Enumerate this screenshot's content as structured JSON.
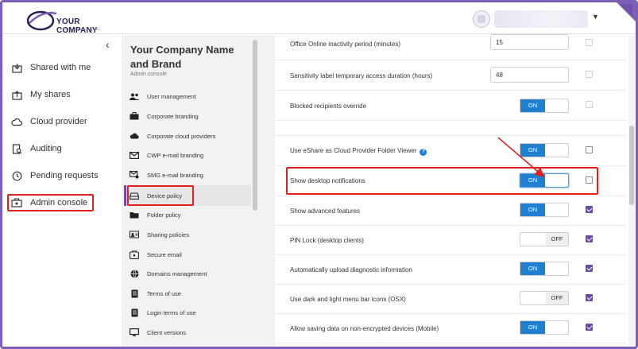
{
  "header": {
    "logo_text": "YOUR COMPANY",
    "logo_subtext": "NAME AND BRANDING"
  },
  "sidebar": {
    "collapse_icon": "chevron-left-icon",
    "items": [
      {
        "label": "Shared with me",
        "icon": "inbox-icon"
      },
      {
        "label": "My shares",
        "icon": "upload-icon"
      },
      {
        "label": "Cloud provider",
        "icon": "cloud-icon"
      },
      {
        "label": "Auditing",
        "icon": "audit-icon"
      },
      {
        "label": "Pending requests",
        "icon": "clock-icon"
      },
      {
        "label": "Admin console",
        "icon": "admin-icon"
      }
    ]
  },
  "subnav": {
    "title": "Your Company Name and Brand",
    "subtitle": "Admin console",
    "items": [
      {
        "label": "User management",
        "icon": "users-icon"
      },
      {
        "label": "Corporate branding",
        "icon": "briefcase-icon"
      },
      {
        "label": "Corporate cloud providers",
        "icon": "cloud-icon"
      },
      {
        "label": "CWP e-mail branding",
        "icon": "mail-icon"
      },
      {
        "label": "SMG e-mail branding",
        "icon": "mail-settings-icon"
      },
      {
        "label": "Device policy",
        "icon": "drive-icon"
      },
      {
        "label": "Folder policy",
        "icon": "folder-icon"
      },
      {
        "label": "Sharing policies",
        "icon": "share-icon"
      },
      {
        "label": "Secure email",
        "icon": "secure-mail-icon"
      },
      {
        "label": "Domains management",
        "icon": "globe-icon"
      },
      {
        "label": "Terms of use",
        "icon": "document-icon"
      },
      {
        "label": "Login terms of use",
        "icon": "document-icon"
      },
      {
        "label": "Client versions",
        "icon": "monitor-icon"
      }
    ]
  },
  "settings": {
    "office_inactivity": {
      "label": "Office Online inactivity period (minutes)",
      "value": "15"
    },
    "sensitivity_duration": {
      "label": "Sensitivity label temporary access duration (hours)",
      "value": "48"
    },
    "blocked_recipients": {
      "label": "Blocked recipients override",
      "toggle": "ON"
    },
    "eshare_viewer": {
      "label": "Use eShare as Cloud Provider Folder Viewer",
      "toggle": "ON"
    },
    "desktop_notifications": {
      "label": "Show desktop notifications",
      "toggle": "ON"
    },
    "advanced_features": {
      "label": "Show advanced features",
      "toggle": "ON"
    },
    "pin_lock": {
      "label": "PIN Lock (desktop clients)",
      "toggle": "OFF"
    },
    "upload_diagnostic": {
      "label": "Automatically upload diagnostic information",
      "toggle": "ON"
    },
    "dark_light_icons": {
      "label": "Use dark and light menu bar icons (OSX)",
      "toggle": "OFF"
    },
    "non_encrypted": {
      "label": "Allow saving data on non-encrypted devices (Mobile)",
      "toggle": "ON"
    }
  },
  "colors": {
    "accent": "#6b4aa8",
    "toggle_on": "#1f7fd1",
    "highlight": "#e0201b"
  }
}
